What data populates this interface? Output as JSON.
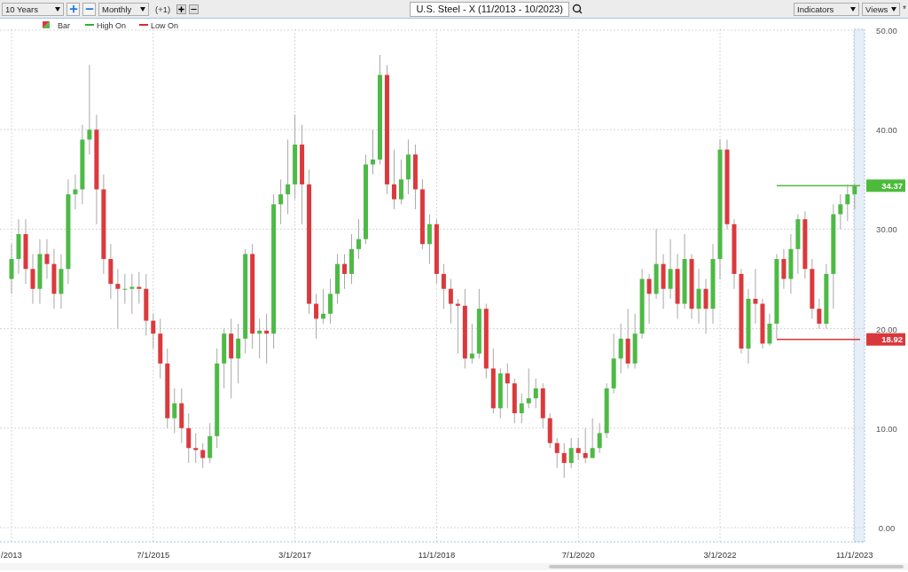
{
  "toolbar": {
    "range": "10 Years",
    "interval": "Monthly",
    "offset": "(+1)",
    "symbol": "U.S. Steel - X (11/2013 - 10/2023)",
    "indicators": "Indicators",
    "views": "Views",
    "modified": "*"
  },
  "legend": [
    {
      "kind": "bar",
      "label": "Bar"
    },
    {
      "kind": "line",
      "label": "High On",
      "color": "#2fb12f"
    },
    {
      "kind": "line",
      "label": "Low On",
      "color": "#d92b2b"
    }
  ],
  "chart": {
    "chart_data": {
      "type": "candlestick",
      "grid": true,
      "ylim": [
        0,
        50
      ],
      "categories": [
        "/2013",
        null,
        null,
        null,
        null,
        null,
        null,
        null,
        null,
        null,
        null,
        null,
        null,
        null,
        null,
        null,
        null,
        null,
        null,
        null,
        "7/1/2015",
        null,
        null,
        null,
        null,
        null,
        null,
        null,
        null,
        null,
        null,
        null,
        null,
        null,
        null,
        null,
        null,
        null,
        null,
        null,
        "3/1/2017",
        null,
        null,
        null,
        null,
        null,
        null,
        null,
        null,
        null,
        null,
        null,
        null,
        null,
        null,
        null,
        null,
        null,
        null,
        null,
        "11/1/2018",
        null,
        null,
        null,
        null,
        null,
        null,
        null,
        null,
        null,
        null,
        null,
        null,
        null,
        null,
        null,
        null,
        null,
        null,
        null,
        "7/1/2020",
        null,
        null,
        null,
        null,
        null,
        null,
        null,
        null,
        null,
        null,
        null,
        null,
        null,
        null,
        null,
        null,
        null,
        null,
        null,
        "3/1/2022",
        null,
        null,
        null,
        null,
        null,
        null,
        null,
        null,
        null,
        null,
        null,
        null,
        null,
        null,
        null,
        null,
        null,
        null,
        "11/1/2023"
      ],
      "yticks": [
        {
          "value": 0,
          "label": "0.00"
        },
        {
          "value": 10,
          "label": "10.00"
        },
        {
          "value": 20,
          "label": "20.00"
        },
        {
          "value": 30,
          "label": "30.00"
        },
        {
          "value": 40,
          "label": "40.00"
        },
        {
          "value": 50,
          "label": "50.00"
        }
      ],
      "ohlc": [
        [
          25,
          28.5,
          23.5,
          27
        ],
        [
          27,
          31,
          25.5,
          29.5
        ],
        [
          29.5,
          31,
          24.5,
          26
        ],
        [
          26,
          27.5,
          22.5,
          24
        ],
        [
          24,
          29,
          22.5,
          27.5
        ],
        [
          27.5,
          29,
          25,
          26.5
        ],
        [
          26.5,
          28,
          22,
          23.5
        ],
        [
          23.5,
          27.5,
          22,
          26
        ],
        [
          26,
          35,
          24.5,
          33.5
        ],
        [
          33.5,
          35.5,
          32,
          34
        ],
        [
          34,
          40.5,
          32.5,
          39
        ],
        [
          39,
          46.5,
          37.5,
          40
        ],
        [
          40,
          41.5,
          30.5,
          34
        ],
        [
          34,
          35.5,
          25.5,
          27
        ],
        [
          27,
          28.5,
          23,
          24.5
        ],
        [
          24.5,
          26,
          20,
          24
        ],
        [
          24,
          25.5,
          22.5,
          24
        ],
        [
          24,
          25.5,
          21.5,
          24.2
        ],
        [
          24.2,
          25.7,
          22.5,
          24
        ],
        [
          24,
          25.5,
          19.3,
          20.8
        ],
        [
          20.8,
          21.5,
          18,
          19.5
        ],
        [
          19.5,
          21,
          15,
          16.5
        ],
        [
          16.5,
          18,
          10,
          11
        ],
        [
          11,
          14,
          9.5,
          12.5
        ],
        [
          12.5,
          14,
          8.5,
          10
        ],
        [
          10,
          11.5,
          6.5,
          8
        ],
        [
          8,
          9.5,
          6.5,
          7.8
        ],
        [
          7.8,
          8.5,
          6,
          7
        ],
        [
          7,
          10.5,
          6.5,
          9.2
        ],
        [
          9.2,
          18,
          8,
          16.5
        ],
        [
          16.5,
          20,
          14,
          19.5
        ],
        [
          19.5,
          21,
          13,
          17
        ],
        [
          17,
          20.5,
          14.5,
          19
        ],
        [
          19,
          28,
          17.5,
          27.5
        ],
        [
          27.5,
          28.5,
          18,
          19.5
        ],
        [
          19.5,
          21,
          17,
          19.8
        ],
        [
          19.8,
          21.5,
          16.5,
          19.5
        ],
        [
          19.5,
          33.5,
          18,
          32.5
        ],
        [
          32.5,
          35,
          30.5,
          33.5
        ],
        [
          33.5,
          39,
          31.5,
          34.5
        ],
        [
          34.5,
          41.5,
          33,
          38.5
        ],
        [
          38.5,
          40.5,
          30.5,
          34.5
        ],
        [
          34.5,
          36,
          21.5,
          22.5
        ],
        [
          22.5,
          23.5,
          19,
          21
        ],
        [
          21,
          24,
          20.5,
          21.5
        ],
        [
          21.5,
          25,
          20.5,
          23.5
        ],
        [
          23.5,
          27.5,
          22.5,
          26.5
        ],
        [
          26.5,
          27.5,
          24,
          25.5
        ],
        [
          25.5,
          29.5,
          24.5,
          28
        ],
        [
          28,
          31,
          27,
          29
        ],
        [
          29,
          37.5,
          28.5,
          36.5
        ],
        [
          36.5,
          40,
          35.5,
          37
        ],
        [
          37,
          47.5,
          36.5,
          45.5
        ],
        [
          45.5,
          46.5,
          33.5,
          34.5
        ],
        [
          34.5,
          38,
          32,
          33
        ],
        [
          33,
          37,
          32.5,
          35
        ],
        [
          35,
          39,
          33.5,
          37.5
        ],
        [
          37.5,
          38.5,
          32,
          34
        ],
        [
          34,
          35,
          28,
          28.5
        ],
        [
          28.5,
          31.5,
          26.5,
          30.5
        ],
        [
          30.5,
          31,
          24.5,
          25.5
        ],
        [
          25.5,
          26.5,
          22,
          24
        ],
        [
          24,
          25,
          20.5,
          22.5
        ],
        [
          22.5,
          23,
          17.5,
          22.3
        ],
        [
          22.3,
          24,
          16,
          17
        ],
        [
          17,
          20.5,
          16.5,
          17.5
        ],
        [
          17.5,
          24,
          17,
          22
        ],
        [
          22,
          22.5,
          15,
          16
        ],
        [
          16,
          18,
          11.5,
          12
        ],
        [
          12,
          16,
          11,
          15.5
        ],
        [
          15.5,
          16.5,
          12,
          14.5
        ],
        [
          14.5,
          15,
          10.5,
          11.5
        ],
        [
          11.5,
          13.5,
          10.5,
          12.5
        ],
        [
          12.5,
          16,
          12,
          13
        ],
        [
          13,
          15,
          12,
          14
        ],
        [
          14,
          14.5,
          10,
          11
        ],
        [
          11,
          11.5,
          8,
          8.5
        ],
        [
          8.5,
          9,
          6,
          7.5
        ],
        [
          7.5,
          8.5,
          5,
          6.5
        ],
        [
          6.5,
          9,
          6,
          8
        ],
        [
          8,
          9,
          6.8,
          7.5
        ],
        [
          7.5,
          10,
          6.5,
          7
        ],
        [
          7,
          11,
          7,
          8
        ],
        [
          8,
          10.5,
          7.5,
          9.5
        ],
        [
          9.5,
          14.5,
          9,
          14
        ],
        [
          14,
          19.5,
          13.5,
          17
        ],
        [
          17,
          20.5,
          15.5,
          19
        ],
        [
          19,
          22,
          16,
          16.5
        ],
        [
          16.5,
          21.5,
          16,
          19.5
        ],
        [
          19.5,
          26,
          19,
          25
        ],
        [
          25,
          25.5,
          20.5,
          23.5
        ],
        [
          23.5,
          30,
          23,
          26.5
        ],
        [
          26.5,
          27.5,
          22,
          24
        ],
        [
          24,
          29,
          23,
          26
        ],
        [
          26,
          27.5,
          21,
          22.5
        ],
        [
          22.5,
          29.5,
          22,
          27
        ],
        [
          27,
          27.5,
          21,
          22
        ],
        [
          22,
          26,
          20.5,
          24
        ],
        [
          24,
          25,
          19.5,
          22
        ],
        [
          22,
          28.5,
          20.5,
          27
        ],
        [
          27,
          39,
          25,
          38
        ],
        [
          38,
          39,
          30,
          30.5
        ],
        [
          30.5,
          31,
          24,
          25.5
        ],
        [
          25.5,
          26,
          17.5,
          18
        ],
        [
          18,
          24,
          16.5,
          23
        ],
        [
          23,
          26,
          20.5,
          22.5
        ],
        [
          22.5,
          23,
          18,
          18.5
        ],
        [
          18.5,
          21.5,
          18.3,
          20.5
        ],
        [
          20.5,
          27.5,
          19,
          27
        ],
        [
          27,
          28,
          24,
          25
        ],
        [
          25,
          29.5,
          23.5,
          28
        ],
        [
          28,
          31.5,
          25.5,
          31
        ],
        [
          31,
          31.8,
          25,
          26
        ],
        [
          26,
          27,
          21,
          22
        ],
        [
          22,
          23,
          20,
          20.5
        ],
        [
          20.5,
          26.5,
          20,
          25.5
        ],
        [
          25.5,
          32.5,
          22,
          31.5
        ],
        [
          31.5,
          33.5,
          30,
          32.5
        ],
        [
          32.5,
          34.5,
          30.8,
          33.5
        ],
        [
          33.5,
          34.6,
          32,
          34.4
        ]
      ],
      "ref_lines": [
        {
          "axis": "y",
          "value": 34.37,
          "label": "34.37",
          "color": "#4cbb3c"
        },
        {
          "axis": "y",
          "value": 18.92,
          "label": "18.92",
          "color": "#d9373b"
        }
      ]
    }
  }
}
